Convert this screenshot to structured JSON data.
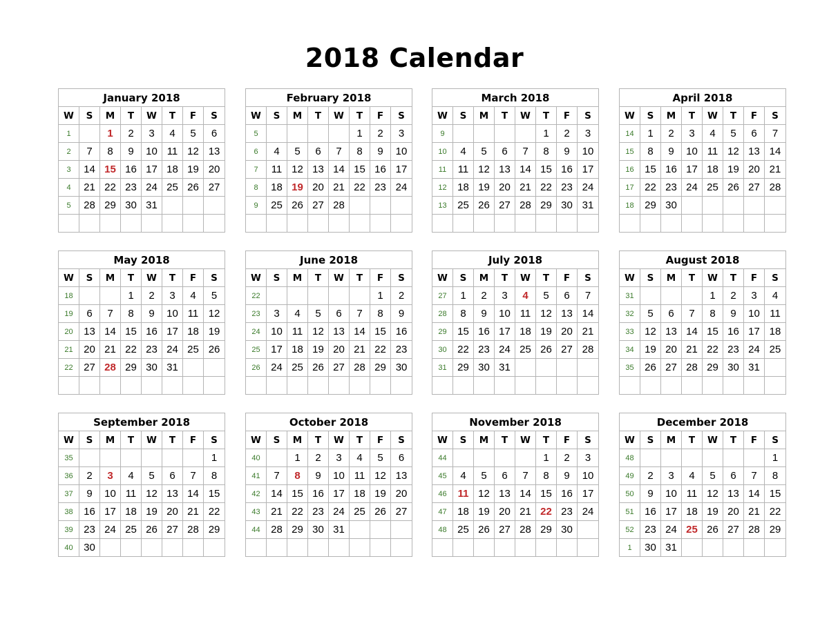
{
  "page": {
    "title": "2018 Calendar"
  },
  "day_headers": [
    "W",
    "S",
    "M",
    "T",
    "W",
    "T",
    "F",
    "S"
  ],
  "colors": {
    "week_number": "#3a7a2a",
    "holiday": "#c0282a",
    "grid": "#b4b4b4"
  },
  "months": [
    {
      "name": "January 2018",
      "weeks": [
        [
          "1",
          "",
          "1",
          "2",
          "3",
          "4",
          "5",
          "6"
        ],
        [
          "2",
          "7",
          "8",
          "9",
          "10",
          "11",
          "12",
          "13"
        ],
        [
          "3",
          "14",
          "15",
          "16",
          "17",
          "18",
          "19",
          "20"
        ],
        [
          "4",
          "21",
          "22",
          "23",
          "24",
          "25",
          "26",
          "27"
        ],
        [
          "5",
          "28",
          "29",
          "30",
          "31",
          "",
          "",
          ""
        ],
        [
          "",
          "",
          "",
          "",
          "",
          "",
          "",
          ""
        ]
      ],
      "holidays": [
        "1",
        "15"
      ]
    },
    {
      "name": "February 2018",
      "weeks": [
        [
          "5",
          "",
          "",
          "",
          "",
          "1",
          "2",
          "3"
        ],
        [
          "6",
          "4",
          "5",
          "6",
          "7",
          "8",
          "9",
          "10"
        ],
        [
          "7",
          "11",
          "12",
          "13",
          "14",
          "15",
          "16",
          "17"
        ],
        [
          "8",
          "18",
          "19",
          "20",
          "21",
          "22",
          "23",
          "24"
        ],
        [
          "9",
          "25",
          "26",
          "27",
          "28",
          "",
          "",
          ""
        ],
        [
          "",
          "",
          "",
          "",
          "",
          "",
          "",
          ""
        ]
      ],
      "holidays": [
        "19"
      ]
    },
    {
      "name": "March 2018",
      "weeks": [
        [
          "9",
          "",
          "",
          "",
          "",
          "1",
          "2",
          "3"
        ],
        [
          "10",
          "4",
          "5",
          "6",
          "7",
          "8",
          "9",
          "10"
        ],
        [
          "11",
          "11",
          "12",
          "13",
          "14",
          "15",
          "16",
          "17"
        ],
        [
          "12",
          "18",
          "19",
          "20",
          "21",
          "22",
          "23",
          "24"
        ],
        [
          "13",
          "25",
          "26",
          "27",
          "28",
          "29",
          "30",
          "31"
        ],
        [
          "",
          "",
          "",
          "",
          "",
          "",
          "",
          ""
        ]
      ],
      "holidays": []
    },
    {
      "name": "April 2018",
      "weeks": [
        [
          "14",
          "1",
          "2",
          "3",
          "4",
          "5",
          "6",
          "7"
        ],
        [
          "15",
          "8",
          "9",
          "10",
          "11",
          "12",
          "13",
          "14"
        ],
        [
          "16",
          "15",
          "16",
          "17",
          "18",
          "19",
          "20",
          "21"
        ],
        [
          "17",
          "22",
          "23",
          "24",
          "25",
          "26",
          "27",
          "28"
        ],
        [
          "18",
          "29",
          "30",
          "",
          "",
          "",
          "",
          ""
        ],
        [
          "",
          "",
          "",
          "",
          "",
          "",
          "",
          ""
        ]
      ],
      "holidays": []
    },
    {
      "name": "May 2018",
      "weeks": [
        [
          "18",
          "",
          "",
          "1",
          "2",
          "3",
          "4",
          "5"
        ],
        [
          "19",
          "6",
          "7",
          "8",
          "9",
          "10",
          "11",
          "12"
        ],
        [
          "20",
          "13",
          "14",
          "15",
          "16",
          "17",
          "18",
          "19"
        ],
        [
          "21",
          "20",
          "21",
          "22",
          "23",
          "24",
          "25",
          "26"
        ],
        [
          "22",
          "27",
          "28",
          "29",
          "30",
          "31",
          "",
          ""
        ],
        [
          "",
          "",
          "",
          "",
          "",
          "",
          "",
          ""
        ]
      ],
      "holidays": [
        "28"
      ]
    },
    {
      "name": "June 2018",
      "weeks": [
        [
          "22",
          "",
          "",
          "",
          "",
          "",
          "1",
          "2"
        ],
        [
          "23",
          "3",
          "4",
          "5",
          "6",
          "7",
          "8",
          "9"
        ],
        [
          "24",
          "10",
          "11",
          "12",
          "13",
          "14",
          "15",
          "16"
        ],
        [
          "25",
          "17",
          "18",
          "19",
          "20",
          "21",
          "22",
          "23"
        ],
        [
          "26",
          "24",
          "25",
          "26",
          "27",
          "28",
          "29",
          "30"
        ],
        [
          "",
          "",
          "",
          "",
          "",
          "",
          "",
          ""
        ]
      ],
      "holidays": []
    },
    {
      "name": "July 2018",
      "weeks": [
        [
          "27",
          "1",
          "2",
          "3",
          "4",
          "5",
          "6",
          "7"
        ],
        [
          "28",
          "8",
          "9",
          "10",
          "11",
          "12",
          "13",
          "14"
        ],
        [
          "29",
          "15",
          "16",
          "17",
          "18",
          "19",
          "20",
          "21"
        ],
        [
          "30",
          "22",
          "23",
          "24",
          "25",
          "26",
          "27",
          "28"
        ],
        [
          "31",
          "29",
          "30",
          "31",
          "",
          "",
          "",
          ""
        ],
        [
          "",
          "",
          "",
          "",
          "",
          "",
          "",
          ""
        ]
      ],
      "holidays": [
        "4"
      ]
    },
    {
      "name": "August 2018",
      "weeks": [
        [
          "31",
          "",
          "",
          "",
          "1",
          "2",
          "3",
          "4"
        ],
        [
          "32",
          "5",
          "6",
          "7",
          "8",
          "9",
          "10",
          "11"
        ],
        [
          "33",
          "12",
          "13",
          "14",
          "15",
          "16",
          "17",
          "18"
        ],
        [
          "34",
          "19",
          "20",
          "21",
          "22",
          "23",
          "24",
          "25"
        ],
        [
          "35",
          "26",
          "27",
          "28",
          "29",
          "30",
          "31",
          ""
        ],
        [
          "",
          "",
          "",
          "",
          "",
          "",
          "",
          ""
        ]
      ],
      "holidays": []
    },
    {
      "name": "September 2018",
      "weeks": [
        [
          "35",
          "",
          "",
          "",
          "",
          "",
          "",
          "1"
        ],
        [
          "36",
          "2",
          "3",
          "4",
          "5",
          "6",
          "7",
          "8"
        ],
        [
          "37",
          "9",
          "10",
          "11",
          "12",
          "13",
          "14",
          "15"
        ],
        [
          "38",
          "16",
          "17",
          "18",
          "19",
          "20",
          "21",
          "22"
        ],
        [
          "39",
          "23",
          "24",
          "25",
          "26",
          "27",
          "28",
          "29"
        ],
        [
          "40",
          "30",
          "",
          "",
          "",
          "",
          "",
          ""
        ]
      ],
      "holidays": [
        "3"
      ]
    },
    {
      "name": "October 2018",
      "weeks": [
        [
          "40",
          "",
          "1",
          "2",
          "3",
          "4",
          "5",
          "6"
        ],
        [
          "41",
          "7",
          "8",
          "9",
          "10",
          "11",
          "12",
          "13"
        ],
        [
          "42",
          "14",
          "15",
          "16",
          "17",
          "18",
          "19",
          "20"
        ],
        [
          "43",
          "21",
          "22",
          "23",
          "24",
          "25",
          "26",
          "27"
        ],
        [
          "44",
          "28",
          "29",
          "30",
          "31",
          "",
          "",
          ""
        ],
        [
          "",
          "",
          "",
          "",
          "",
          "",
          "",
          ""
        ]
      ],
      "holidays": [
        "8"
      ]
    },
    {
      "name": "November 2018",
      "weeks": [
        [
          "44",
          "",
          "",
          "",
          "",
          "1",
          "2",
          "3"
        ],
        [
          "45",
          "4",
          "5",
          "6",
          "7",
          "8",
          "9",
          "10"
        ],
        [
          "46",
          "11",
          "12",
          "13",
          "14",
          "15",
          "16",
          "17"
        ],
        [
          "47",
          "18",
          "19",
          "20",
          "21",
          "22",
          "23",
          "24"
        ],
        [
          "48",
          "25",
          "26",
          "27",
          "28",
          "29",
          "30",
          ""
        ],
        [
          "",
          "",
          "",
          "",
          "",
          "",
          "",
          ""
        ]
      ],
      "holidays": [
        "11",
        "22"
      ]
    },
    {
      "name": "December 2018",
      "weeks": [
        [
          "48",
          "",
          "",
          "",
          "",
          "",
          "",
          "1"
        ],
        [
          "49",
          "2",
          "3",
          "4",
          "5",
          "6",
          "7",
          "8"
        ],
        [
          "50",
          "9",
          "10",
          "11",
          "12",
          "13",
          "14",
          "15"
        ],
        [
          "51",
          "16",
          "17",
          "18",
          "19",
          "20",
          "21",
          "22"
        ],
        [
          "52",
          "23",
          "24",
          "25",
          "26",
          "27",
          "28",
          "29"
        ],
        [
          "1",
          "30",
          "31",
          "",
          "",
          "",
          "",
          ""
        ]
      ],
      "holidays": [
        "25"
      ]
    }
  ]
}
